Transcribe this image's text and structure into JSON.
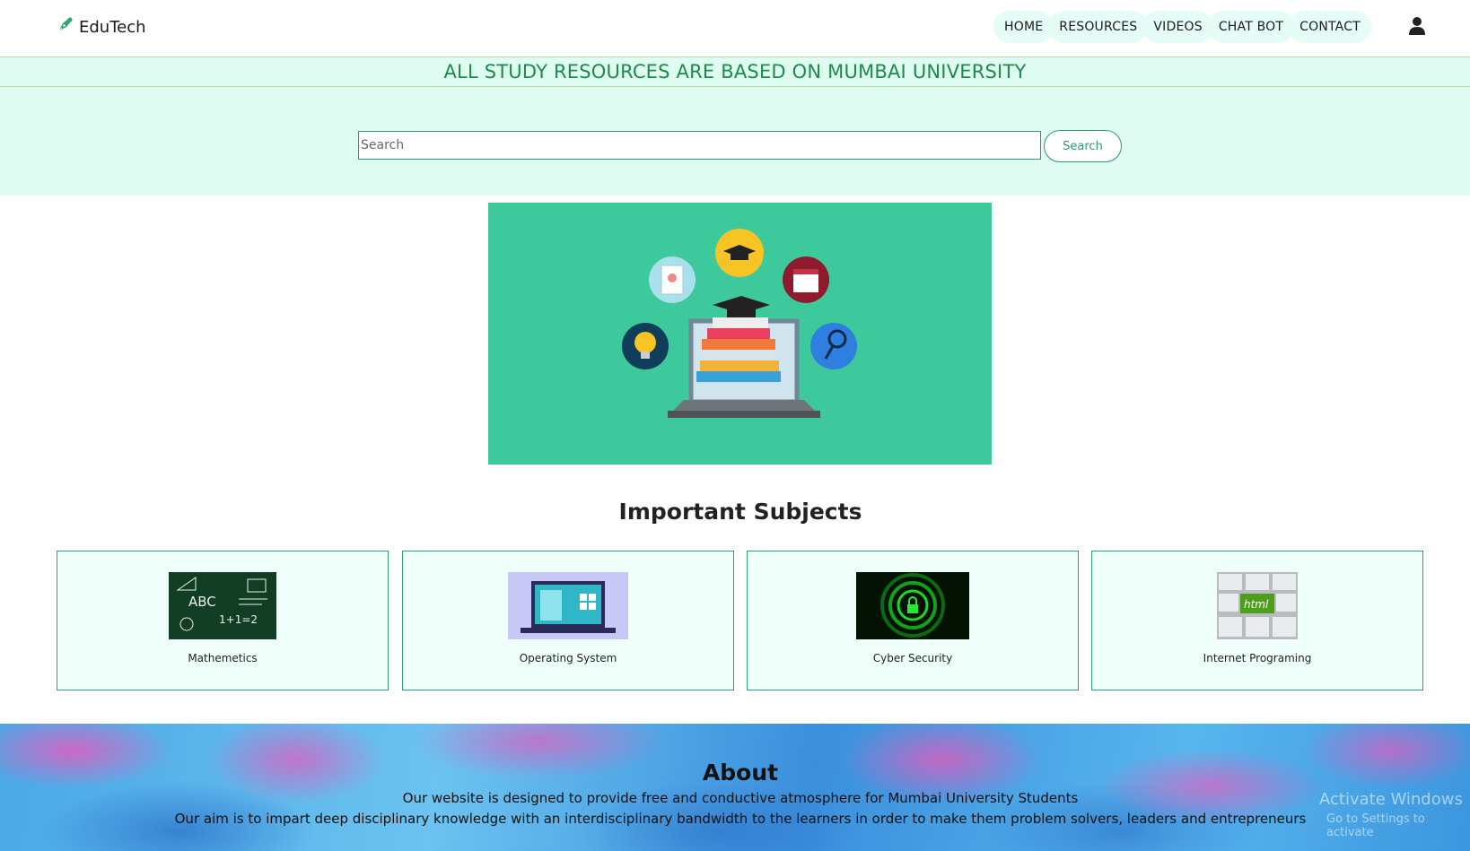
{
  "brand": {
    "name": "EduTech",
    "logo_icon": "pen-nib-icon",
    "color": "#25a96f"
  },
  "nav": {
    "items": [
      "HOME",
      "RESOURCES",
      "VIDEOS",
      "CHAT BOT",
      "CONTACT"
    ],
    "user_icon": "user-icon"
  },
  "banner": {
    "text": "ALL STUDY RESOURCES ARE BASED ON MUMBAI UNIVERSITY",
    "color": "#1e8a4a"
  },
  "search": {
    "placeholder": "Search",
    "value": "",
    "button_label": "Search"
  },
  "hero": {
    "background": "#3dc99b",
    "illustration": "laptop-with-books-icon"
  },
  "subjects": {
    "title": "Important Subjects",
    "cards": [
      {
        "label": "Mathemetics",
        "image": "math-chalkboard-image"
      },
      {
        "label": "Operating System",
        "image": "windows-laptop-image"
      },
      {
        "label": "Cyber Security",
        "image": "green-lock-image"
      },
      {
        "label": "Internet Programing",
        "image": "html-keyboard-image"
      }
    ]
  },
  "about": {
    "title": "About",
    "line1": "Our website is designed to provide free and conductive atmosphere for Mumbai University Students",
    "line2": "Our aim is to impart deep disciplinary knowledge with an interdisciplinary bandwidth to the learners in order to make them problem solvers, leaders and entrepreneurs"
  },
  "watermark": {
    "line1": "Activate Windows",
    "line2": "Go to Settings to activate"
  },
  "colors": {
    "accent": "#2c9a6b",
    "mint_bg": "#dffcf3",
    "card_bg": "#effffa"
  }
}
